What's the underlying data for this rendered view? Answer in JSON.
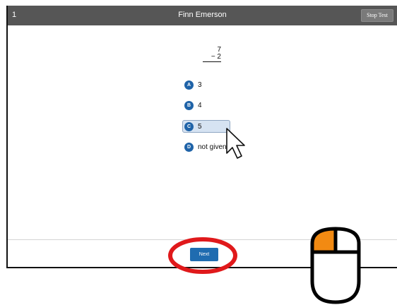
{
  "header": {
    "question_number": "1",
    "student_name": "Finn Emerson",
    "stop_label": "Stop Test"
  },
  "problem": {
    "top": "7",
    "bottom": "− 2"
  },
  "choices": [
    {
      "letter": "A",
      "text": "3"
    },
    {
      "letter": "B",
      "text": "4"
    },
    {
      "letter": "C",
      "text": "5",
      "selected": true
    },
    {
      "letter": "D",
      "text": "not given"
    }
  ],
  "footer": {
    "next_label": "Next"
  },
  "colors": {
    "header_bg": "#565656",
    "accent": "#1f63a8",
    "selected_bg": "#d6e3f2",
    "highlight_circle": "#e0191b",
    "mouse_button": "#f28a12"
  },
  "icons": {
    "pointer": "arrow-cursor-icon",
    "mouse": "mouse-left-click-icon",
    "highlight": "red-circle-highlight"
  }
}
